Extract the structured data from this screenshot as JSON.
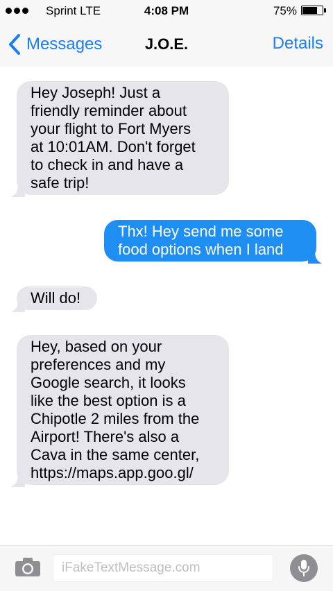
{
  "status_bar": {
    "carrier": "Sprint  LTE",
    "time": "4:08 PM",
    "battery": "75%",
    "battery_level": 0.75
  },
  "nav": {
    "back_label": "Messages",
    "title": "J.O.E.",
    "details_label": "Details"
  },
  "messages": [
    {
      "direction": "incoming",
      "text": "Hey Joseph! Just a\nfriendly reminder about\nyour flight to Fort Myers\nat 10:01AM. Don't forget\nto check in and have a\nsafe trip!"
    },
    {
      "direction": "outgoing",
      "text": "Thx! Hey send me some\nfood options when I land"
    },
    {
      "direction": "incoming",
      "text": "Will do!"
    },
    {
      "direction": "incoming",
      "text": "Hey, based on your\npreferences and my\nGoogle search, it looks\nlike the best option is a\nChipotle 2 miles from the\nAirport! There's also a\nCava in the same center,\nhttps://maps.app.goo.gl/"
    }
  ],
  "input": {
    "placeholder": "iFakeTextMessage.com"
  },
  "colors": {
    "accent": "#1a7ef0",
    "incoming_bubble": "#e6e5eb",
    "outgoing_bubble": "#1f8ef3"
  },
  "icons": {
    "back": "chevron-left-icon",
    "camera": "camera-icon",
    "mic": "microphone-icon"
  }
}
